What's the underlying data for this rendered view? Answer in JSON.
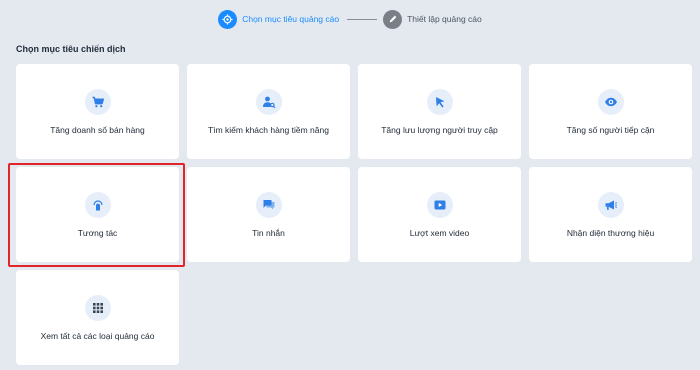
{
  "stepper": {
    "steps": [
      {
        "label": "Chọn mục tiêu quảng cáo",
        "icon": "target-icon",
        "state": "active"
      },
      {
        "label": "Thiết lập quảng cáo",
        "icon": "pencil-icon",
        "state": "inactive"
      }
    ]
  },
  "section": {
    "title": "Chọn mục tiêu chiến dịch"
  },
  "objectives": [
    {
      "label": "Tăng doanh số bán hàng",
      "icon": "cart-icon"
    },
    {
      "label": "Tìm kiếm khách hàng tiềm năng",
      "icon": "user-search-icon"
    },
    {
      "label": "Tăng lưu lượng người truy cập",
      "icon": "cursor-icon"
    },
    {
      "label": "Tăng số người tiếp cận",
      "icon": "eye-icon"
    },
    {
      "label": "Tương tác",
      "icon": "tap-icon"
    },
    {
      "label": "Tin nhắn",
      "icon": "chat-icon"
    },
    {
      "label": "Lượt xem video",
      "icon": "video-play-icon"
    },
    {
      "label": "Nhận diện thương hiệu",
      "icon": "megaphone-icon"
    },
    {
      "label": "Xem tất cả các loại quảng cáo",
      "icon": "grid-icon"
    }
  ],
  "colors": {
    "accent": "#1a8cff",
    "icon_blue": "#2f7fe8",
    "icon_bg": "#e6eefa",
    "highlight": "#e0262b",
    "background": "#e4e9f0"
  }
}
